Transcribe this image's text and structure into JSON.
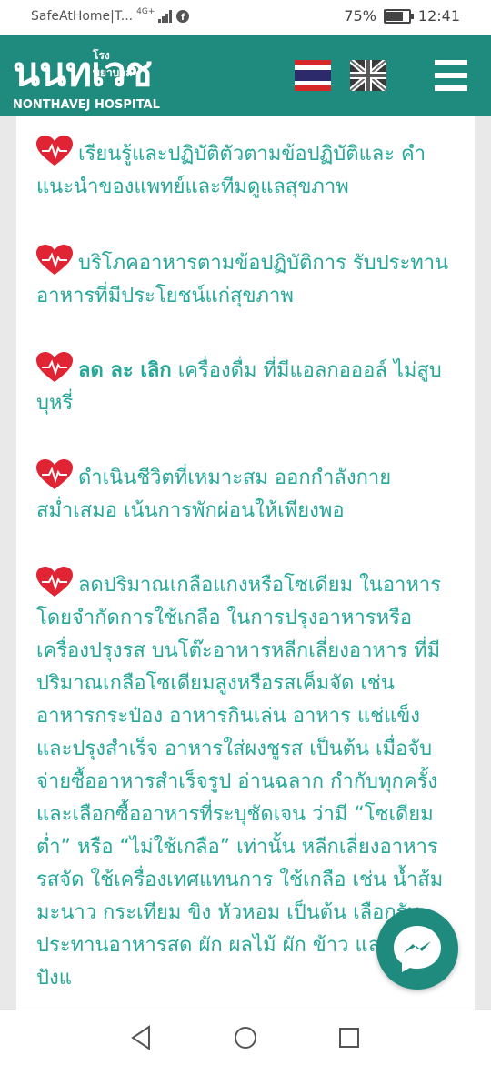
{
  "status_bar": {
    "carrier": "SafeAtHome|T...",
    "network": "4G+",
    "battery_percent": "75%",
    "battery_level": 0.75,
    "time": "12:41"
  },
  "header": {
    "logo_thai_small": "โรงพยาบาล",
    "logo_thai_big": "นนทเวช",
    "logo_english": "NONTHAVEJ HOSPITAL",
    "brand_color": "#1e8b7e"
  },
  "items": [
    {
      "bold": "",
      "text": "เรียนรู้และปฏิบัติตัวตามข้อปฏิบัติและ คำแนะนำของแพทย์และทีมดูแลสุขภาพ"
    },
    {
      "bold": "",
      "text": "บริโภคอาหารตามข้อปฏิบัติการ รับประทานอาหารที่มีประโยชน์แก่สุขภาพ"
    },
    {
      "bold": "ลด ละ เลิก",
      "text": " เครื่องดื่ม ที่มีแอลกอออล์ ไม่สูบบุหรี่"
    },
    {
      "bold": "",
      "text": "ดำเนินชีวิตที่เหมาะสม ออกกำลังกายสม่ำเสมอ เน้นการพักผ่อนให้เพียงพอ"
    },
    {
      "bold": "",
      "text": "ลดปริมาณเกลือแกงหรือโซเดียม ในอาหาร โดยจำกัดการใช้เกลือ ในการปรุงอาหารหรือ เครื่องปรุงรส บนโต๊ะอาหารหลีกเลี่ยงอาหาร ที่มีปริมาณเกลือโซเดียมสูงหรือรสเค็มจัด เช่น อาหารกระป๋อง อาหารกินเล่น อาหาร แช่แข็งและปรุงสำเร็จ อาหารใส่ผงชูรส เป็นต้น เมื่อจับจ่ายซื้ออาหารสำเร็จรูป อ่านฉลาก กำกับทุกครั้งและเลือกซื้ออาหารที่ระบุชัดเจน ว่ามี “โซเดียมต่ำ” หรือ “ไม่ใช้เกลือ” เท่านั้น หลีกเลี่ยงอาหารรสจัด ใช้เครื่องเทศแทนการ ใช้เกลือ เช่น น้ำส้ม มะนาว กระเทียม ขิง หัวหอม เป็นต้น เลือกรับประทานอาหารสด ผัก ผลไม้ ผัก ข้าว และขนมปังแ"
    }
  ],
  "icons": {
    "heart": "heart-pulse-icon",
    "thai_flag": "thai-flag-icon",
    "uk_flag": "uk-flag-icon",
    "menu": "hamburger-menu-icon",
    "messenger": "messenger-icon"
  },
  "colors": {
    "text": "#27a89a",
    "heart": "#e02433"
  }
}
